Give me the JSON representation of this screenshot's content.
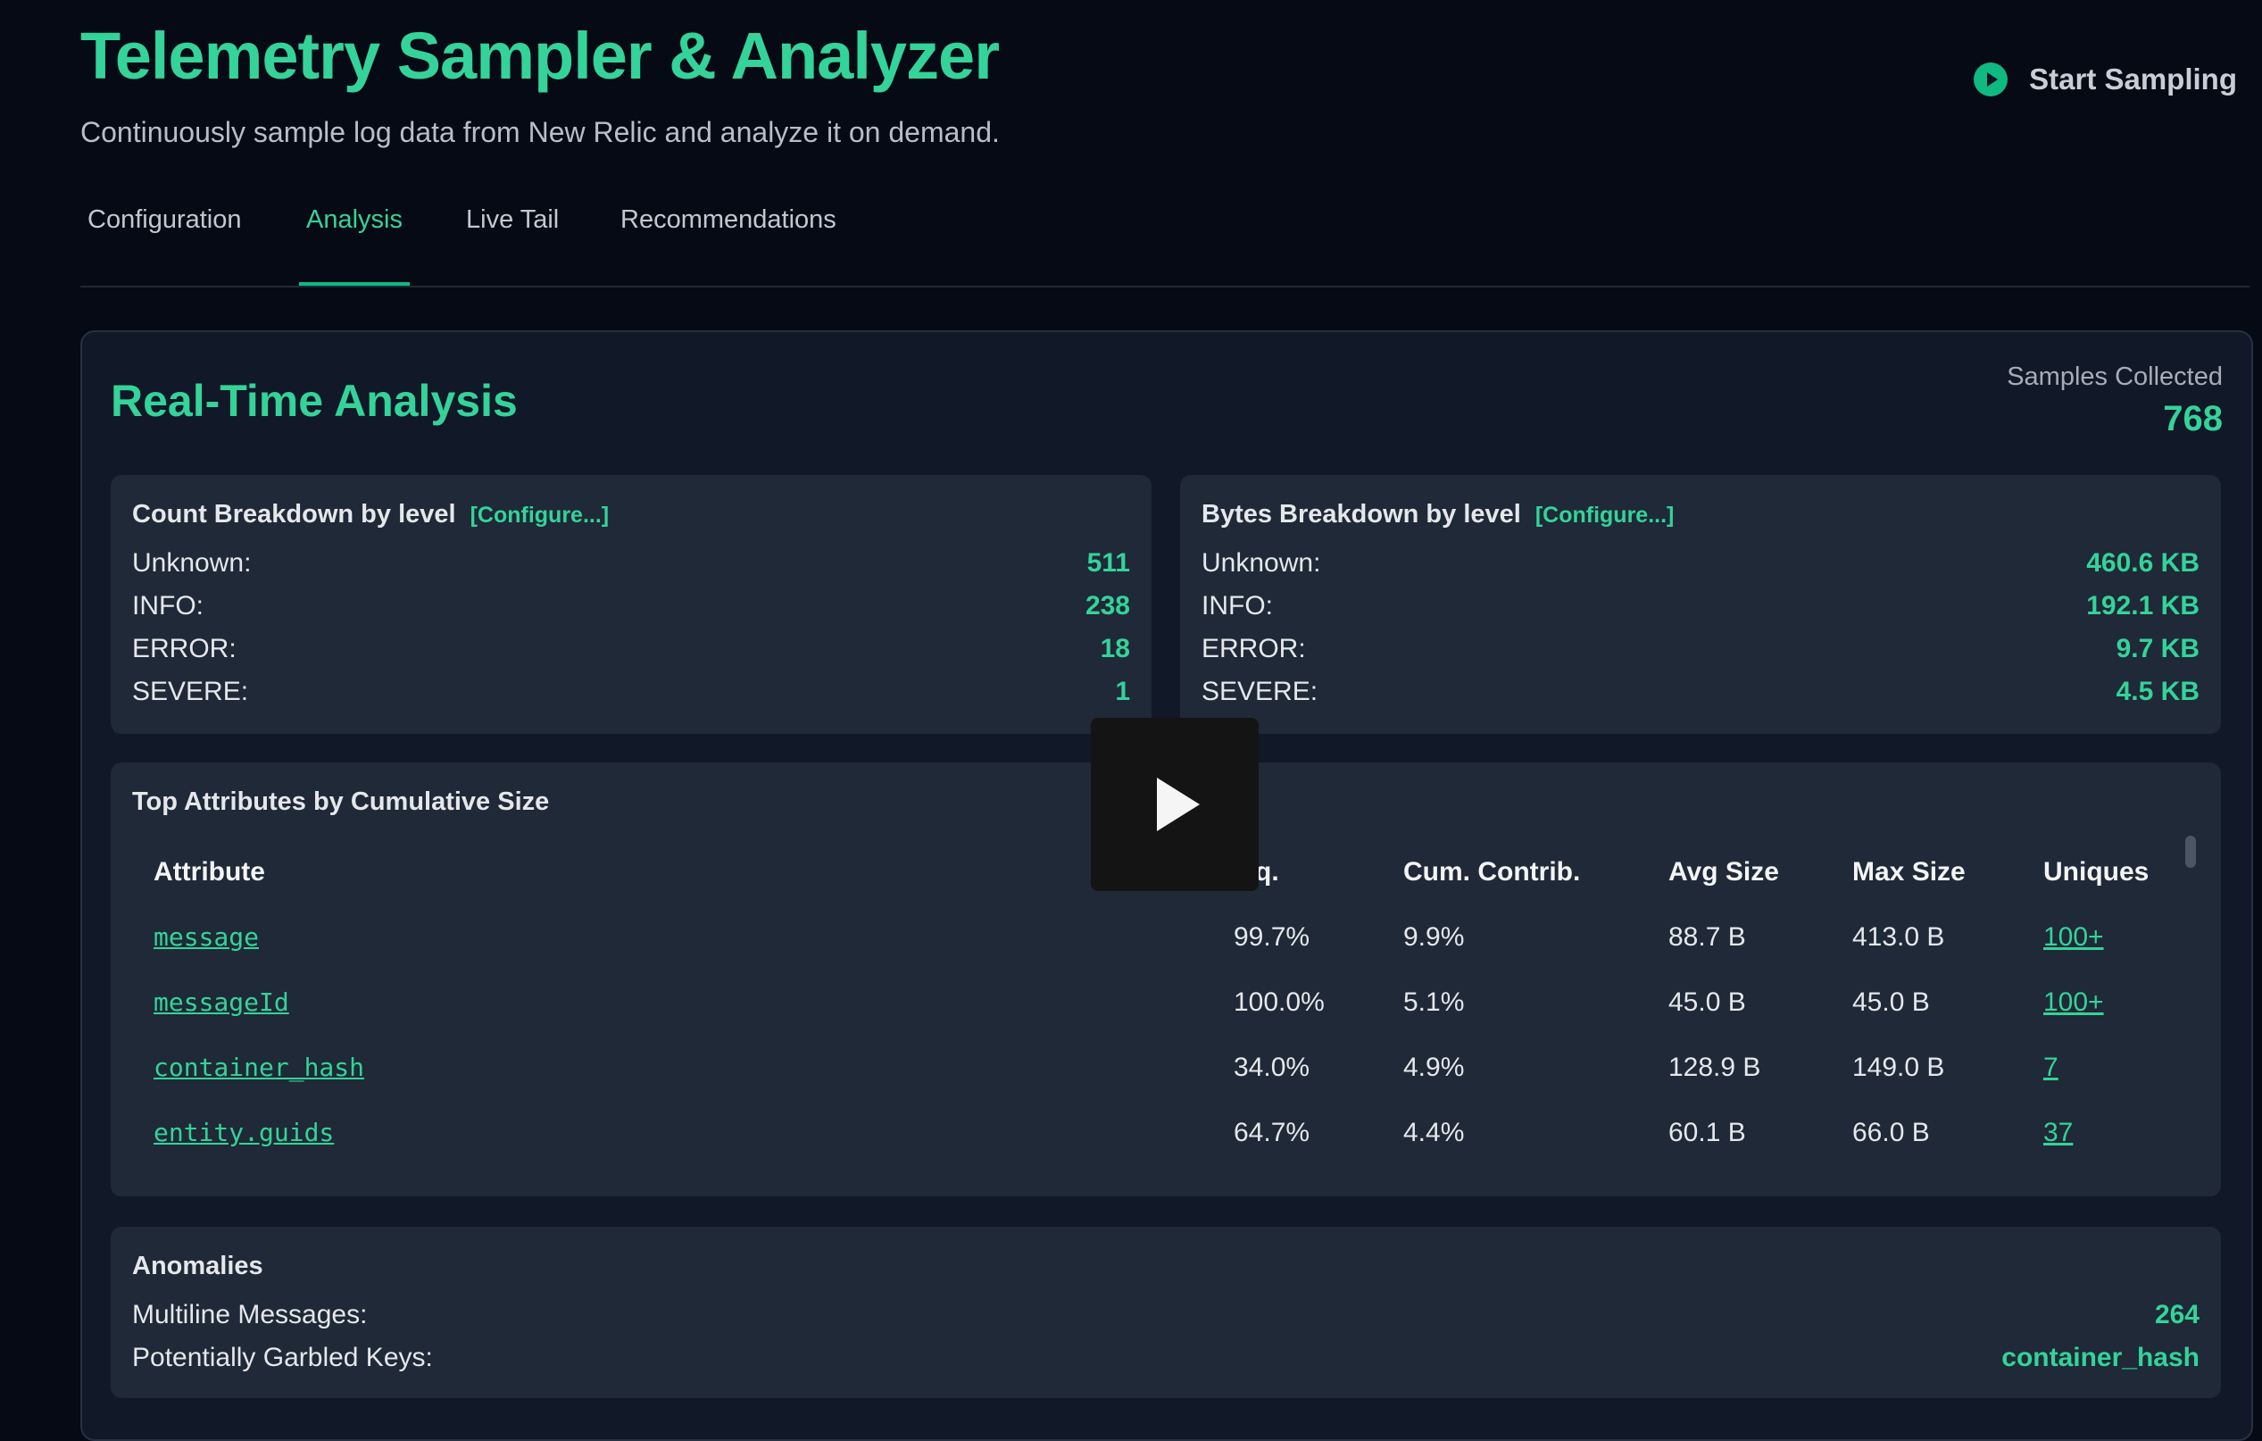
{
  "header": {
    "title": "Telemetry Sampler & Analyzer",
    "subtitle": "Continuously sample log data from New Relic and analyze it on demand.",
    "start_label": "Start Sampling"
  },
  "tabs": [
    {
      "label": "Configuration",
      "active": false
    },
    {
      "label": "Analysis",
      "active": true
    },
    {
      "label": "Live Tail",
      "active": false
    },
    {
      "label": "Recommendations",
      "active": false
    }
  ],
  "analysis": {
    "title": "Real-Time Analysis",
    "samples_label": "Samples Collected",
    "samples_value": "768"
  },
  "count_breakdown": {
    "title": "Count Breakdown by level",
    "configure": "[Configure...]",
    "rows": [
      {
        "label": "Unknown:",
        "value": "511"
      },
      {
        "label": "INFO:",
        "value": "238"
      },
      {
        "label": "ERROR:",
        "value": "18"
      },
      {
        "label": "SEVERE:",
        "value": "1"
      }
    ]
  },
  "bytes_breakdown": {
    "title": "Bytes Breakdown by level",
    "configure": "[Configure...]",
    "rows": [
      {
        "label": "Unknown:",
        "value": "460.6 KB"
      },
      {
        "label": "INFO:",
        "value": "192.1 KB"
      },
      {
        "label": "ERROR:",
        "value": "9.7 KB"
      },
      {
        "label": "SEVERE:",
        "value": "4.5 KB"
      }
    ]
  },
  "attributes": {
    "title": "Top Attributes by Cumulative Size",
    "columns": [
      "Attribute",
      "q.",
      "Cum. Contrib.",
      "Avg Size",
      "Max Size",
      "Uniques"
    ],
    "rows": [
      {
        "attribute": "message",
        "freq": "99.7%",
        "cum": "9.9%",
        "avg": "88.7 B",
        "max": "413.0 B",
        "uniques": "100+"
      },
      {
        "attribute": "messageId",
        "freq": "100.0%",
        "cum": "5.1%",
        "avg": "45.0 B",
        "max": "45.0 B",
        "uniques": "100+"
      },
      {
        "attribute": "container_hash",
        "freq": "34.0%",
        "cum": "4.9%",
        "avg": "128.9 B",
        "max": "149.0 B",
        "uniques": "7"
      },
      {
        "attribute": "entity.guids",
        "freq": "64.7%",
        "cum": "4.4%",
        "avg": "60.1 B",
        "max": "66.0 B",
        "uniques": "37"
      }
    ]
  },
  "anomalies": {
    "title": "Anomalies",
    "rows": [
      {
        "label": "Multiline Messages:",
        "value": "264"
      },
      {
        "label": "Potentially Garbled Keys:",
        "value": "container_hash"
      }
    ]
  },
  "colors": {
    "accent": "#34d399",
    "background": "#060a14",
    "panel": "#111827",
    "card": "#1f2937"
  },
  "icons": {
    "start": "play-circle-icon",
    "overlay": "video-play-icon"
  }
}
